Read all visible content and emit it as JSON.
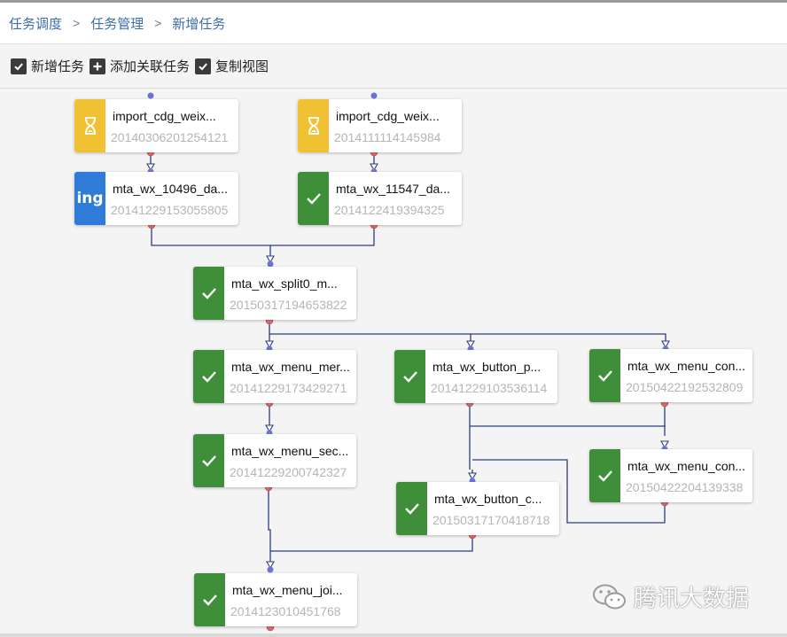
{
  "breadcrumb": {
    "items": [
      "任务调度",
      "任务管理",
      "新增任务"
    ],
    "separator": ">"
  },
  "toolbar": {
    "new_task": "新增任务",
    "add_related": "添加关联任务",
    "copy_view": "复制视图"
  },
  "nodes": [
    {
      "name": "import_cdg_weix...",
      "timestamp": "20140306201254121",
      "status": "waiting",
      "status_icon": "hourglass-icon"
    },
    {
      "name": "import_cdg_weix...",
      "timestamp": "2014111114145984 ",
      "status": "waiting",
      "status_icon": "hourglass-icon"
    },
    {
      "name": "mta_wx_10496_da...",
      "timestamp": "20141229153055805",
      "status": "running",
      "status_icon": "ing",
      "status_text": "ing"
    },
    {
      "name": "mta_wx_11547_da...",
      "timestamp": "2014122419394325 ",
      "status": "done",
      "status_icon": "check-icon"
    },
    {
      "name": "mta_wx_split0_m...",
      "timestamp": "20150317194653822",
      "status": "done",
      "status_icon": "check-icon"
    },
    {
      "name": "mta_wx_menu_mer...",
      "timestamp": "20141229173429271",
      "status": "done",
      "status_icon": "check-icon"
    },
    {
      "name": "mta_wx_button_p...",
      "timestamp": "20141229103536114",
      "status": "done",
      "status_icon": "check-icon"
    },
    {
      "name": "mta_wx_menu_con...",
      "timestamp": "20150422192532809",
      "status": "done",
      "status_icon": "check-icon"
    },
    {
      "name": "mta_wx_menu_sec...",
      "timestamp": "20141229200742327",
      "status": "done",
      "status_icon": "check-icon"
    },
    {
      "name": "mta_wx_menu_con...",
      "timestamp": "20150422204139338",
      "status": "done",
      "status_icon": "check-icon"
    },
    {
      "name": "mta_wx_button_c...",
      "timestamp": "20150317170418718",
      "status": "done",
      "status_icon": "check-icon"
    },
    {
      "name": "mta_wx_menu_joi...",
      "timestamp": "2014123010451768 ",
      "status": "done",
      "status_icon": "check-icon"
    }
  ],
  "colors": {
    "done": "#3e8e3a",
    "waiting": "#f0c233",
    "running": "#2f7bd8",
    "link": "#2d3f7c",
    "port_out": "#e07070",
    "port_in": "#6b74d6",
    "breadcrumb_link": "#3d6ea8"
  },
  "watermark": {
    "text": "腾讯大数据",
    "logo_icon": "wechat-icon"
  }
}
